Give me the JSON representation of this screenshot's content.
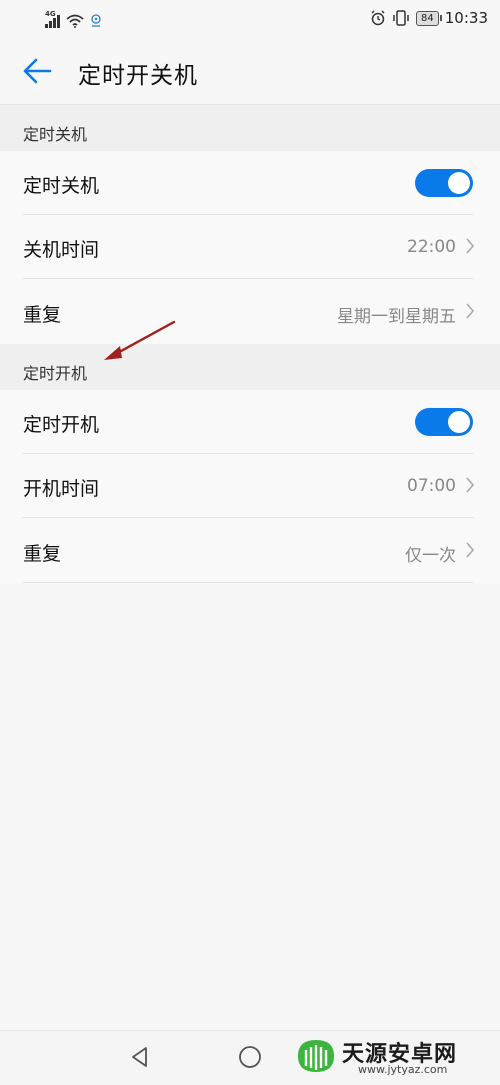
{
  "status": {
    "network": "4G",
    "battery": "84",
    "time": "10:33"
  },
  "appbar": {
    "title": "定时开关机"
  },
  "shutdown": {
    "header": "定时关机",
    "toggle_label": "定时关机",
    "toggle_on": true,
    "time_label": "关机时间",
    "time_value": "22:00",
    "repeat_label": "重复",
    "repeat_value": "星期一到星期五"
  },
  "startup": {
    "header": "定时开机",
    "toggle_label": "定时开机",
    "toggle_on": true,
    "time_label": "开机时间",
    "time_value": "07:00",
    "repeat_label": "重复",
    "repeat_value": "仅一次"
  },
  "watermark": {
    "name": "天源安卓网",
    "url": "www.jytyaz.com"
  },
  "colors": {
    "accent": "#0a7aea",
    "annotation_arrow": "#a02020"
  }
}
